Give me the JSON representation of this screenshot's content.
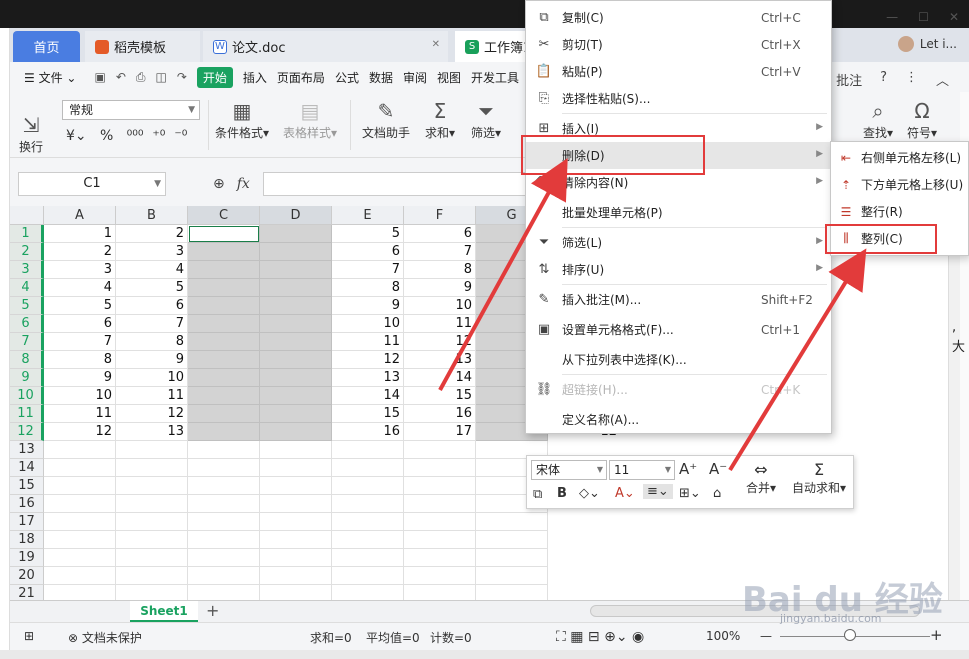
{
  "tabs": {
    "home": "首页",
    "template": "稻壳模板",
    "doc": "论文.doc",
    "workbook": "工作簿1",
    "user": "Let i..."
  },
  "menubar": {
    "file": "文件",
    "start": "开始",
    "items": [
      "插入",
      "页面布局",
      "公式",
      "数据",
      "审阅",
      "视图",
      "开发工具"
    ],
    "right_peek": "批注"
  },
  "ribbon": {
    "format_value": "常规",
    "wrap": "换行",
    "cond_format": "条件格式",
    "table_style": "表格样式",
    "doc_helper": "文档助手",
    "sum": "求和",
    "filter": "筛选",
    "find": "查找",
    "symbol": "符号"
  },
  "formula": {
    "namebox": "C1",
    "fx": "fx"
  },
  "grid": {
    "columns": [
      "A",
      "B",
      "C",
      "D",
      "E",
      "F",
      "G"
    ],
    "rows": [
      "1",
      "2",
      "3",
      "4",
      "5",
      "6",
      "7",
      "8",
      "9",
      "10",
      "11",
      "12",
      "13",
      "14",
      "15",
      "16",
      "17",
      "18",
      "19",
      "20",
      "21"
    ],
    "A": [
      "1",
      "2",
      "3",
      "4",
      "5",
      "6",
      "7",
      "8",
      "9",
      "10",
      "11",
      "12"
    ],
    "B": [
      "2",
      "3",
      "4",
      "5",
      "6",
      "7",
      "8",
      "9",
      "10",
      "11",
      "12",
      "13"
    ],
    "E": [
      "5",
      "6",
      "7",
      "8",
      "9",
      "10",
      "11",
      "12",
      "13",
      "14",
      "15",
      "16"
    ],
    "F": [
      "6",
      "7",
      "8",
      "9",
      "10",
      "11",
      "12",
      "13",
      "14",
      "15",
      "16",
      "17"
    ],
    "partial_value": "12"
  },
  "context_menu": {
    "items": [
      {
        "label": "复制(C)",
        "shortcut": "Ctrl+C",
        "icon": "copy-icon"
      },
      {
        "label": "剪切(T)",
        "shortcut": "Ctrl+X",
        "icon": "scissors-icon"
      },
      {
        "label": "粘贴(P)",
        "shortcut": "Ctrl+V",
        "icon": "paste-icon"
      },
      {
        "label": "选择性粘贴(S)...",
        "shortcut": "",
        "icon": "paste-special-icon"
      },
      {
        "label": "插入(I)",
        "shortcut": "",
        "icon": "insert-icon"
      },
      {
        "label": "删除(D)",
        "shortcut": "",
        "icon": ""
      },
      {
        "label": "清除内容(N)",
        "shortcut": "",
        "icon": "eraser-icon"
      },
      {
        "label": "批量处理单元格(P)",
        "shortcut": "",
        "icon": ""
      },
      {
        "label": "筛选(L)",
        "shortcut": "",
        "icon": "filter-icon"
      },
      {
        "label": "排序(U)",
        "shortcut": "",
        "icon": "sort-icon"
      },
      {
        "label": "插入批注(M)...",
        "shortcut": "Shift+F2",
        "icon": "comment-icon"
      },
      {
        "label": "设置单元格格式(F)...",
        "shortcut": "Ctrl+1",
        "icon": "format-cells-icon"
      },
      {
        "label": "从下拉列表中选择(K)...",
        "shortcut": "",
        "icon": ""
      },
      {
        "label": "超链接(H)...",
        "shortcut": "Ctrl+K",
        "icon": "link-icon"
      },
      {
        "label": "定义名称(A)...",
        "shortcut": "",
        "icon": ""
      }
    ]
  },
  "submenu": {
    "items": [
      "右侧单元格左移(L)",
      "下方单元格上移(U)",
      "整行(R)",
      "整列(C)"
    ]
  },
  "mini_toolbar": {
    "font": "宋体",
    "size": "11",
    "merge": "合并",
    "autosum": "自动求和"
  },
  "sheet": {
    "tab": "Sheet1"
  },
  "status": {
    "protect": "文档未保护",
    "sum": "求和=0",
    "avg": "平均值=0",
    "count": "计数=0",
    "zoom": "100%"
  },
  "watermark": {
    "brand": "Bai du 经验",
    "url": "jingyan.baidu.com"
  },
  "colors": {
    "accent": "#1aa260",
    "home_tab": "#4a7de1",
    "annotation": "#e23b3b"
  }
}
